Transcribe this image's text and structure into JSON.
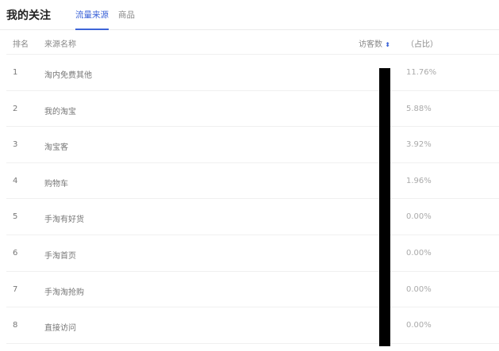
{
  "header": {
    "title": "我的关注",
    "tabs": [
      {
        "label": "流量来源",
        "active": true
      },
      {
        "label": "商品",
        "active": false
      }
    ]
  },
  "table": {
    "columns": {
      "rank": "排名",
      "source": "来源名称",
      "visitors": "访客数",
      "share": "（占比）"
    },
    "rows": [
      {
        "rank": "1",
        "source": "淘内免费其他",
        "share": "11.76%"
      },
      {
        "rank": "2",
        "source": "我的淘宝",
        "share": "5.88%"
      },
      {
        "rank": "3",
        "source": "淘宝客",
        "share": "3.92%"
      },
      {
        "rank": "4",
        "source": "购物车",
        "share": "1.96%"
      },
      {
        "rank": "5",
        "source": "手淘有好货",
        "share": "0.00%"
      },
      {
        "rank": "6",
        "source": "手淘首页",
        "share": "0.00%"
      },
      {
        "rank": "7",
        "source": "手淘淘抢购",
        "share": "0.00%"
      },
      {
        "rank": "8",
        "source": "直接访问",
        "share": "0.00%"
      }
    ]
  },
  "colors": {
    "accent": "#3d64d8"
  }
}
